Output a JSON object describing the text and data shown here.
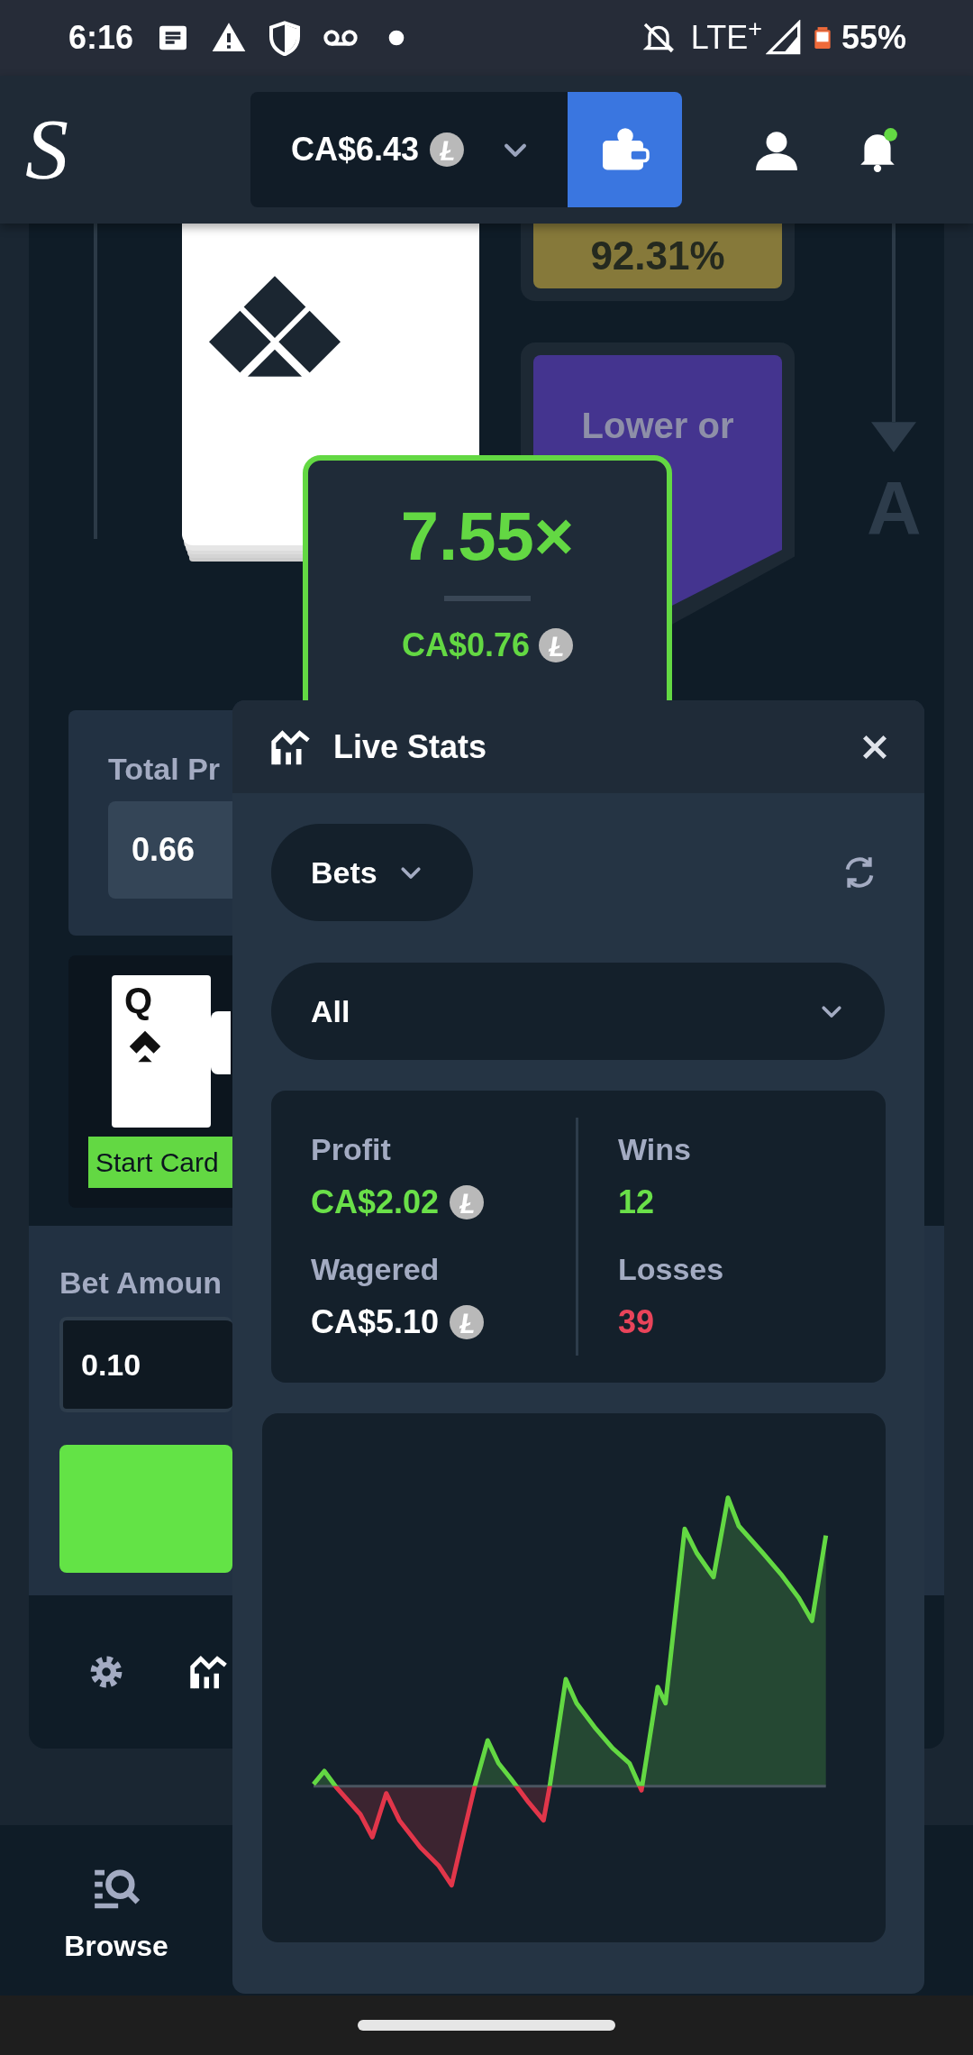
{
  "status_bar": {
    "time": "6:16",
    "network": "LTE$^{+}$",
    "battery": "55%"
  },
  "header": {
    "logo": "S",
    "balance": "CA$6.43"
  },
  "game": {
    "odds_high": "92.31%",
    "odds_low_label": "Lower or",
    "side_letter": "A",
    "multiplier": "7.55×",
    "payout": "CA$0.76"
  },
  "total_profit": {
    "label": "Total Pr",
    "value": "0.66"
  },
  "start_card": {
    "rank": "Q",
    "label": "Start Card"
  },
  "bet_amount": {
    "label": "Bet Amoun",
    "value": "0.10"
  },
  "live_stats": {
    "title": "Live Stats",
    "type_dropdown": "Bets",
    "filter": "All",
    "stats": [
      {
        "label": "Profit",
        "value": "CA$2.02",
        "kind": "money",
        "color": "#6ae049"
      },
      {
        "label": "Wins",
        "value": "12",
        "kind": "count",
        "color": "#6ae049"
      },
      {
        "label": "Wagered",
        "value": "CA$5.10",
        "kind": "money",
        "color": "#ffffff"
      },
      {
        "label": "Losses",
        "value": "39",
        "kind": "count",
        "color": "#e9445a"
      }
    ]
  },
  "bottom_nav": [
    {
      "label": "Browse"
    }
  ]
}
